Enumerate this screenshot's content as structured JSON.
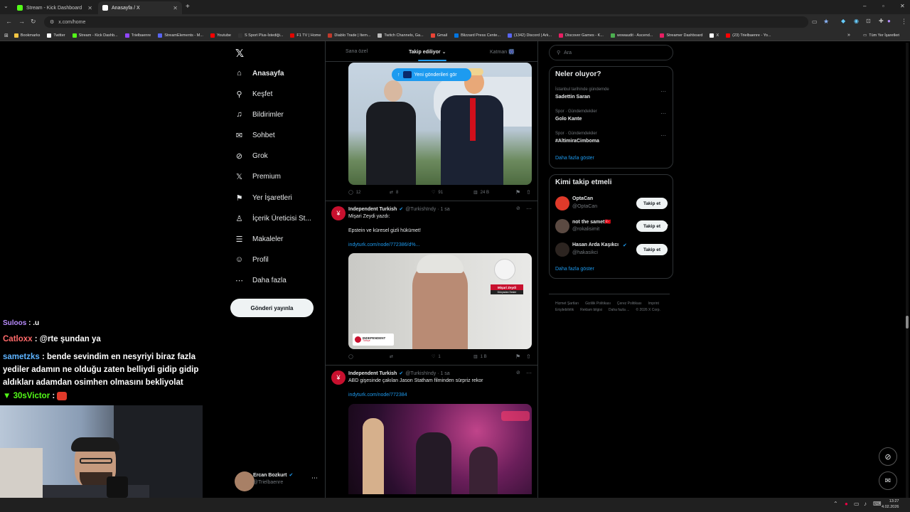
{
  "browser": {
    "tabs": [
      {
        "label": "Stream - Kick Dashboard",
        "color": "#53fc18"
      },
      {
        "label": "Anasayfa / X",
        "color": "#ffffff"
      }
    ],
    "url": "x.com/home",
    "bookmarks": [
      {
        "label": "Bookmarks",
        "color": "#f4c542"
      },
      {
        "label": "Twitter",
        "color": "#ffffff"
      },
      {
        "label": "Stream - Kick Dashb...",
        "color": "#53fc18"
      },
      {
        "label": "Trielbaenre",
        "color": "#9146ff"
      },
      {
        "label": "StreamElements - M...",
        "color": "#5865f2"
      },
      {
        "label": "Youtube",
        "color": "#ff0000"
      },
      {
        "label": "S Sport Plus-İstediği...",
        "color": "#333333"
      },
      {
        "label": "F1 TV | Home",
        "color": "#e10600"
      },
      {
        "label": "Diablo Trade | Item...",
        "color": "#c0392b"
      },
      {
        "label": "Twitch Channels, Ga...",
        "color": "#bbbbbb"
      },
      {
        "label": "Gmail",
        "color": "#ea4335"
      },
      {
        "label": "Blizzard Press Cente...",
        "color": "#0074e0"
      },
      {
        "label": "(1342) Discord | Ark...",
        "color": "#5865f2"
      },
      {
        "label": "Discover Games - K...",
        "color": "#e91e63"
      },
      {
        "label": "wowaudit - Ascend...",
        "color": "#4caf50"
      },
      {
        "label": "Streamer Dashboard",
        "color": "#e91e63"
      },
      {
        "label": "X",
        "color": "#ffffff"
      },
      {
        "label": "(23) Trielbaenre - Yo...",
        "color": "#ff0000"
      }
    ],
    "all_bookmarks": "Tüm Yer İşaretleri"
  },
  "nav": {
    "items": [
      {
        "label": "Anasayfa",
        "icon": "home-icon",
        "glyph": "⌂"
      },
      {
        "label": "Keşfet",
        "icon": "search-icon",
        "glyph": "⚲"
      },
      {
        "label": "Bildirimler",
        "icon": "bell-icon",
        "glyph": "♫"
      },
      {
        "label": "Sohbet",
        "icon": "mail-icon",
        "glyph": "✉"
      },
      {
        "label": "Grok",
        "icon": "grok-icon",
        "glyph": "⊘"
      },
      {
        "label": "Premium",
        "icon": "x-icon",
        "glyph": "𝕏"
      },
      {
        "label": "Yer İşaretleri",
        "icon": "bookmark-icon",
        "glyph": "⚑"
      },
      {
        "label": "İçerik Üreticisi St...",
        "icon": "creator-icon",
        "glyph": "♙"
      },
      {
        "label": "Makaleler",
        "icon": "article-icon",
        "glyph": "☰"
      },
      {
        "label": "Profil",
        "icon": "profile-icon",
        "glyph": "☺"
      },
      {
        "label": "Daha fazla",
        "icon": "more-icon",
        "glyph": "⋯"
      }
    ],
    "post_button": "Gönderi yayınla",
    "account": {
      "name": "Ercan Bozkurt",
      "handle": "@Trielbaenre"
    }
  },
  "feed": {
    "tabs": [
      "Sana özel",
      "Takip ediliyor",
      "Katman 🎆"
    ],
    "new_posts": "Yeni gönderileri gör",
    "tweets": [
      {
        "stats": [
          "12",
          "8",
          "91",
          "24 B"
        ]
      },
      {
        "name": "Independent Turkish",
        "handle": "@TurkishIndy · 1 sa",
        "lines": [
          "Mişari Zeydi yazdı:",
          "Epstein ve küresel gizli hükümet!"
        ],
        "link": "indyturk.com/node/772386/d%...",
        "image_caption": "Mişari Zeydi",
        "image_subcaption": "Dünyadan Sesler",
        "image_logo": "INDEPENDENT",
        "image_logo_sub": "Türkçe",
        "stats": [
          "",
          "",
          "1",
          "1 B"
        ]
      },
      {
        "name": "Independent Turkish",
        "handle": "@TurkishIndy · 1 sa",
        "lines": [
          "ABD gişesinde çakılan Jason Statham filminden sürpriz rekor"
        ],
        "link": "indyturk.com/node/772384",
        "stats": []
      }
    ]
  },
  "right": {
    "search_placeholder": "Ara",
    "trends_title": "Neler oluyor?",
    "trends": [
      {
        "context": "İstanbul tarihinde gündemde",
        "title": "Sadettin Saran"
      },
      {
        "context": "Spor · Gündemdekiler",
        "title": "Golo Kante"
      },
      {
        "context": "Spor · Gündemdekiler",
        "title": "#AltimiraCimboma"
      }
    ],
    "show_more": "Daha fazla göster",
    "follow_title": "Kimi takip etmeli",
    "follow": [
      {
        "name": "OptaCan",
        "handle": "@OptaCan",
        "button": "Takip et"
      },
      {
        "name": "not the samet🇹🇷",
        "handle": "@rokalisimit",
        "button": "Takip et"
      },
      {
        "name": "Hasan Arda Kaşıkcı",
        "handle": "@hakasikci",
        "button": "Takip et"
      }
    ],
    "footer": [
      "Hizmet Şartları",
      "Gizlilik Politikası",
      "Çerez Politikası",
      "Imprint",
      "Erişilebilirlik",
      "Reklam bilgisi",
      "Daha fazla ...",
      "© 2026 X Corp."
    ]
  },
  "chat": {
    "messages": [
      {
        "user": "Suloos",
        "text": ": .u",
        "color": "#b98cff"
      },
      {
        "user": "Catloxx",
        "text": ": @rte şundan ya",
        "color": "#ff6a6a"
      },
      {
        "user": "sametzks",
        "text": ": bende sevindim en nesyriyi biraz fazla yediler adamın ne olduğu zaten belliydi gidip gidip aldıkları adamdan osimhen olmasını bekliyolat",
        "color": "#5db3ff"
      },
      {
        "user": "30sVictor",
        "text": ":",
        "color": "#53fc18"
      }
    ]
  },
  "taskbar": {
    "time": "13:27",
    "date": "4.02.2026"
  }
}
